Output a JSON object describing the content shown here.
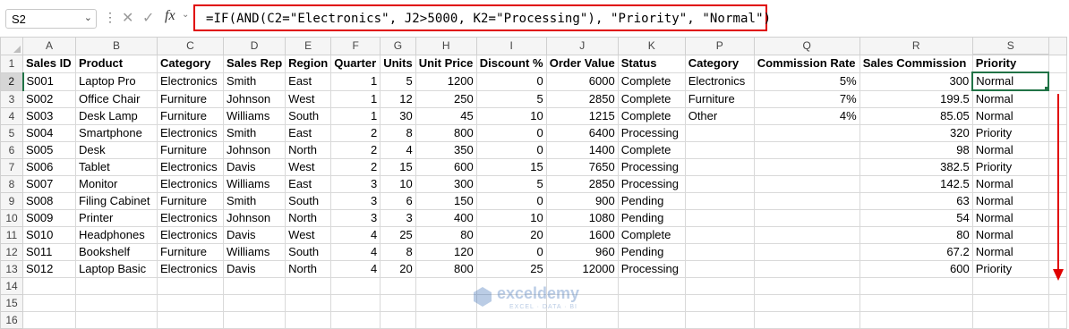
{
  "formula_bar": {
    "name_box": "S2",
    "formula": "=IF(AND(C2=\"Electronics\", J2>5000, K2=\"Processing\"), \"Priority\", \"Normal\")",
    "fx_label": "fx"
  },
  "columns": [
    "A",
    "B",
    "C",
    "D",
    "E",
    "F",
    "G",
    "H",
    "I",
    "J",
    "K",
    "P",
    "Q",
    "R",
    "S"
  ],
  "rows": [
    {
      "n": "1",
      "cells": [
        "Sales ID",
        "Product",
        "Category",
        "Sales Rep",
        "Region",
        "Quarter",
        "Units",
        "Unit Price",
        "Discount %",
        "Order Value",
        "Status",
        "Category",
        "Commission Rate",
        "Sales Commission",
        "Priority"
      ]
    },
    {
      "n": "2",
      "cells": [
        "S001",
        "Laptop Pro",
        "Electronics",
        "Smith",
        "East",
        "1",
        "5",
        "1200",
        "0",
        "6000",
        "Complete",
        "Electronics",
        "5%",
        "300",
        "Normal"
      ]
    },
    {
      "n": "3",
      "cells": [
        "S002",
        "Office Chair",
        "Furniture",
        "Johnson",
        "West",
        "1",
        "12",
        "250",
        "5",
        "2850",
        "Complete",
        "Furniture",
        "7%",
        "199.5",
        "Normal"
      ]
    },
    {
      "n": "4",
      "cells": [
        "S003",
        "Desk Lamp",
        "Furniture",
        "Williams",
        "South",
        "1",
        "30",
        "45",
        "10",
        "1215",
        "Complete",
        "Other",
        "4%",
        "85.05",
        "Normal"
      ]
    },
    {
      "n": "5",
      "cells": [
        "S004",
        "Smartphone",
        "Electronics",
        "Smith",
        "East",
        "2",
        "8",
        "800",
        "0",
        "6400",
        "Processing",
        "",
        "",
        "320",
        "Priority"
      ]
    },
    {
      "n": "6",
      "cells": [
        "S005",
        "Desk",
        "Furniture",
        "Johnson",
        "North",
        "2",
        "4",
        "350",
        "0",
        "1400",
        "Complete",
        "",
        "",
        "98",
        "Normal"
      ]
    },
    {
      "n": "7",
      "cells": [
        "S006",
        "Tablet",
        "Electronics",
        "Davis",
        "West",
        "2",
        "15",
        "600",
        "15",
        "7650",
        "Processing",
        "",
        "",
        "382.5",
        "Priority"
      ]
    },
    {
      "n": "8",
      "cells": [
        "S007",
        "Monitor",
        "Electronics",
        "Williams",
        "East",
        "3",
        "10",
        "300",
        "5",
        "2850",
        "Processing",
        "",
        "",
        "142.5",
        "Normal"
      ]
    },
    {
      "n": "9",
      "cells": [
        "S008",
        "Filing Cabinet",
        "Furniture",
        "Smith",
        "South",
        "3",
        "6",
        "150",
        "0",
        "900",
        "Pending",
        "",
        "",
        "63",
        "Normal"
      ]
    },
    {
      "n": "10",
      "cells": [
        "S009",
        "Printer",
        "Electronics",
        "Johnson",
        "North",
        "3",
        "3",
        "400",
        "10",
        "1080",
        "Pending",
        "",
        "",
        "54",
        "Normal"
      ]
    },
    {
      "n": "11",
      "cells": [
        "S010",
        "Headphones",
        "Electronics",
        "Davis",
        "West",
        "4",
        "25",
        "80",
        "20",
        "1600",
        "Complete",
        "",
        "",
        "80",
        "Normal"
      ]
    },
    {
      "n": "12",
      "cells": [
        "S011",
        "Bookshelf",
        "Furniture",
        "Williams",
        "South",
        "4",
        "8",
        "120",
        "0",
        "960",
        "Pending",
        "",
        "",
        "67.2",
        "Normal"
      ]
    },
    {
      "n": "13",
      "cells": [
        "S012",
        "Laptop Basic",
        "Electronics",
        "Davis",
        "North",
        "4",
        "20",
        "800",
        "25",
        "12000",
        "Processing",
        "",
        "",
        "600",
        "Priority"
      ]
    },
    {
      "n": "14",
      "cells": [
        "",
        "",
        "",
        "",
        "",
        "",
        "",
        "",
        "",
        "",
        "",
        "",
        "",
        "",
        ""
      ]
    },
    {
      "n": "15",
      "cells": [
        "",
        "",
        "",
        "",
        "",
        "",
        "",
        "",
        "",
        "",
        "",
        "",
        "",
        "",
        ""
      ]
    },
    {
      "n": "16",
      "cells": [
        "",
        "",
        "",
        "",
        "",
        "",
        "",
        "",
        "",
        "",
        "",
        "",
        "",
        "",
        ""
      ]
    }
  ],
  "watermark": {
    "name": "exceldemy",
    "tagline": "EXCEL · DATA · BI"
  },
  "colors": {
    "highlight": "#e00000",
    "selection": "#217346"
  }
}
